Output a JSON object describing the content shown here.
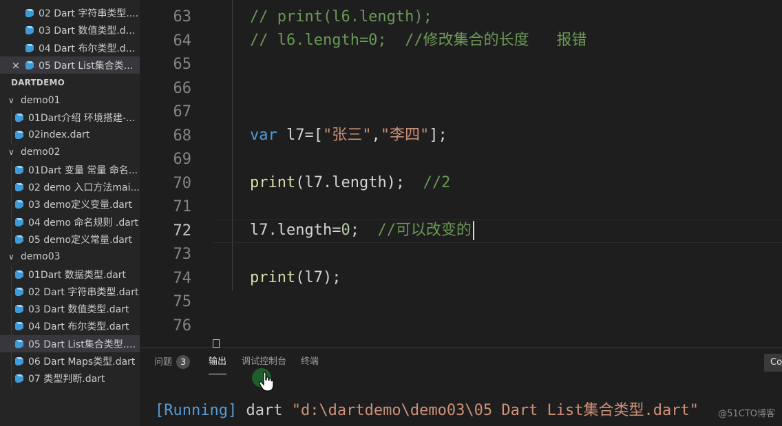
{
  "sidebar": {
    "open_editors": [
      {
        "label": "02 Dart 字符串类型....",
        "selected": false,
        "close": false
      },
      {
        "label": "03 Dart 数值类型.da...",
        "selected": false,
        "close": false
      },
      {
        "label": "04 Dart 布尔类型.da...",
        "selected": false,
        "close": false
      },
      {
        "label": "05 Dart List集合类...",
        "selected": true,
        "close": true,
        "close_glyph": "×"
      }
    ],
    "section_title": "DARTDEMO",
    "folders": [
      {
        "name": "demo01",
        "files": [
          "01Dart介绍 环境搭建-...",
          "02index.dart"
        ]
      },
      {
        "name": "demo02",
        "files": [
          "01Dart 变量 常量 命名...",
          "02 demo 入口方法mai...",
          "03 demo定义变量.dart",
          "04 demo 命名规则 .dart",
          "05 demo定义常量.dart"
        ]
      },
      {
        "name": "demo03",
        "files": [
          "01Dart 数据类型.dart",
          "02 Dart 字符串类型.dart",
          "03 Dart 数值类型.dart",
          "04 Dart 布尔类型.dart",
          "05 Dart List集合类型.d...",
          "06 Dart Maps类型.dart",
          "07 类型判断.dart"
        ]
      }
    ],
    "chevron_glyph": "∨"
  },
  "editor": {
    "line_numbers": [
      "63",
      "64",
      "65",
      "66",
      "67",
      "68",
      "69",
      "70",
      "71",
      "72",
      "73",
      "74",
      "75",
      "76"
    ],
    "active_line": "72",
    "lines": {
      "l63": "// print(l6.length);",
      "l64": "// l6.length=0;  //修改集合的长度   报错",
      "l68_kw": "var",
      "l68_var": " l7=[",
      "l68_s1": "\"张三\"",
      "l68_comma": ",",
      "l68_s2": "\"李四\"",
      "l68_end": "];",
      "l70_fn": "print",
      "l70_rest": "(l7.length);",
      "l70_comment": "  //2",
      "l72_code": "l7.length=",
      "l72_num": "0",
      "l72_semi": ";",
      "l72_comment": "  //可以改变的",
      "l74_fn": "print",
      "l74_rest": "(l7);"
    }
  },
  "panel": {
    "tabs": [
      {
        "label": "问题",
        "badge": "3"
      },
      {
        "label": "输出",
        "active": true
      },
      {
        "label": "调试控制台"
      },
      {
        "label": "终端"
      }
    ],
    "right_button": "Co",
    "output": {
      "running": "[Running]",
      "cmd": " dart ",
      "path": "\"d:\\dartdemo\\demo03\\05 Dart List集合类型.dart\""
    }
  },
  "watermark": "@51CTO博客",
  "icons": {
    "file": "dart-file-icon",
    "close": "close-icon",
    "chevron": "chevron-down-icon"
  },
  "colors": {
    "comment": "#6a9955",
    "keyword": "#569cd6",
    "string": "#ce9178",
    "function": "#dcdcaa"
  }
}
